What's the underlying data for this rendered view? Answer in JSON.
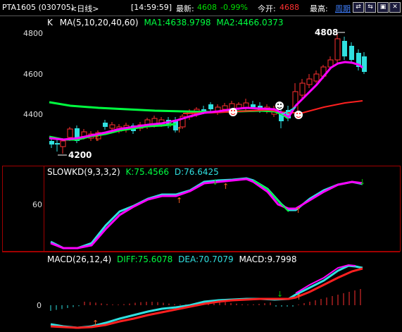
{
  "titlebar": {
    "symbol": "PTA1605 (030705)",
    "period": "<日线>",
    "time": "[14:59:59]",
    "last_label": "最新:",
    "last_value": "4608",
    "change_pct": "-0.99%",
    "open_label": "今开:",
    "open_value": "4688",
    "high_label": "最高:",
    "cycle_link": "周期"
  },
  "price_panel": {
    "indicator_k": "K",
    "ma_label": "MA(5,10,20,40,60)",
    "ma1": "MA1:4638.9798",
    "ma2": "MA2:4466.0373",
    "axis_labels": [
      "4800",
      "4600",
      "4400"
    ],
    "high_marker": "4808",
    "low_marker": "4200"
  },
  "kd_panel": {
    "title": "SLOWKD(9,3,3,2)",
    "k": "K:75.4566",
    "d": "D:76.6425",
    "axis_labels": [
      "60"
    ]
  },
  "macd_panel": {
    "title": "MACD(26,12,4)",
    "diff": "DIFF:75.6078",
    "dea": "DEA:70.7079",
    "macd": "MACD:9.7998",
    "axis_labels": [
      "0"
    ]
  },
  "colors": {
    "up": "#ff3030",
    "down": "#30e0e0",
    "ma1": "#ff00ff",
    "ma2": "#00ff40",
    "ma_red": "#ff2020",
    "border": "#a00000"
  }
}
